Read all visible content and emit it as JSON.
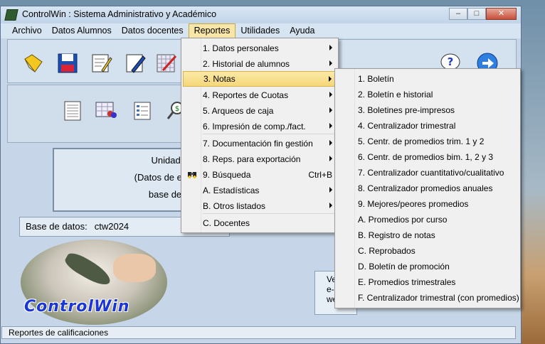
{
  "window": {
    "title": "ControlWin : Sistema Administrativo y Académico",
    "min": "–",
    "max": "□",
    "close": "✕"
  },
  "menubar": [
    "Archivo",
    "Datos Alumnos",
    "Datos docentes",
    "Reportes",
    "Utilidades",
    "Ayuda"
  ],
  "toolbar_icons": [
    "folder-icon",
    "save-disk-icon",
    "edit-notes-icon",
    "pen-icon",
    "grid-pen-icon",
    "help-icon",
    "next-arrow-icon"
  ],
  "sub_icons": [
    "document-icon",
    "users-table-icon",
    "list-icon",
    "money-search-icon"
  ],
  "main": {
    "unit_lines": [
      "Unidad E",
      "(Datos de eje",
      "base de d"
    ],
    "db_label": "Base de datos:",
    "db_value": "ctw2024",
    "logo_text": "ControlWin",
    "ver_lines": [
      "Ve",
      "e-",
      "we"
    ]
  },
  "status": "Reportes de calificaciones",
  "reportes_menu": [
    {
      "label": "1. Datos personales",
      "arrow": true
    },
    {
      "label": "2. Historial de alumnos",
      "arrow": true
    },
    {
      "label": "3. Notas",
      "arrow": true,
      "highlight": true
    },
    {
      "label": "4. Reportes de Cuotas",
      "arrow": true
    },
    {
      "label": "5. Arqueos de caja",
      "arrow": true
    },
    {
      "label": "6. Impresión de comp./fact.",
      "arrow": true
    },
    {
      "label": "7. Documentación fin gestión",
      "arrow": true
    },
    {
      "label": "8. Reps. para exportación",
      "arrow": true
    },
    {
      "label": "9. Búsqueda",
      "shortcut": "Ctrl+B",
      "icon": "binoculars-icon"
    },
    {
      "label": "A. Estadísticas",
      "arrow": true
    },
    {
      "label": "B. Otros listados",
      "arrow": true
    },
    {
      "label": "C. Docentes"
    }
  ],
  "notas_menu": [
    "1. Boletín",
    "2. Boletín e historial",
    "3. Boletines pre-impresos",
    "4. Centralizador trimestral",
    "5. Centr. de promedios trim. 1 y 2",
    "6. Centr. de promedios bim. 1, 2 y 3",
    "7. Centralizador cuantitativo/cualitativo",
    "8. Centralizador promedios anuales",
    "9. Mejores/peores promedios",
    "A. Promedios por curso",
    "B. Registro de notas",
    "C. Reprobados",
    "D. Boletín de promoción",
    "E. Promedios trimestrales",
    "F. Centralizador trimestral (con promedios)"
  ],
  "colors": {
    "highlight": "#f5d77a",
    "logo": "#1a36d6"
  }
}
